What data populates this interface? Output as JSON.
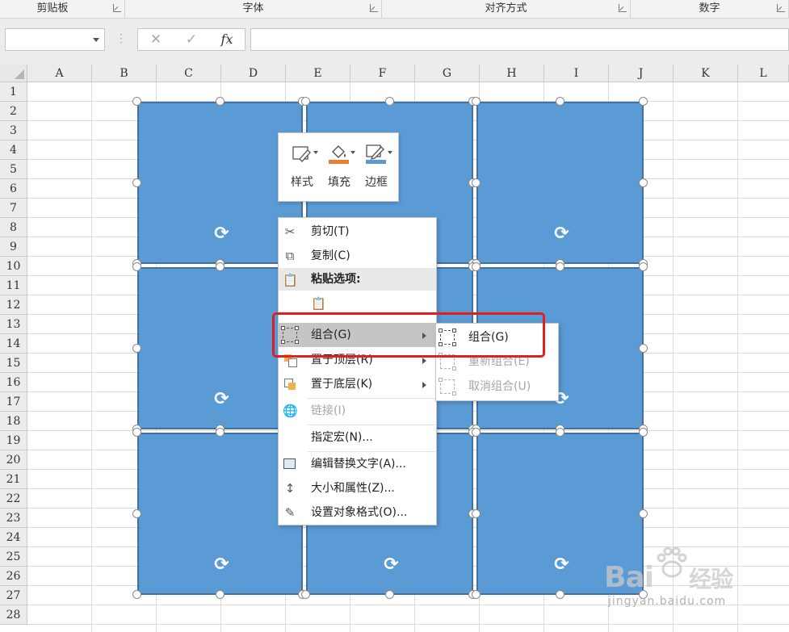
{
  "ribbon": {
    "groups": [
      "剪贴板",
      "字体",
      "对齐方式",
      "数字"
    ]
  },
  "formula_bar": {
    "name_box_value": "",
    "cancel_symbol": "✕",
    "enter_symbol": "✓",
    "fx_label": "fx",
    "formula_value": ""
  },
  "sheet": {
    "columns": [
      "A",
      "B",
      "C",
      "D",
      "E",
      "F",
      "G",
      "H",
      "I",
      "J",
      "K",
      "L"
    ],
    "rows": [
      "1",
      "2",
      "3",
      "4",
      "5",
      "6",
      "7",
      "8",
      "9",
      "10",
      "11",
      "12",
      "13",
      "14",
      "15",
      "16",
      "17",
      "18",
      "19",
      "20",
      "21",
      "22",
      "23",
      "24",
      "25",
      "26",
      "27",
      "28"
    ]
  },
  "shapes": {
    "fill_color": "#5b9bd5",
    "count": 9,
    "selected": true
  },
  "mini_toolbar": {
    "style_label": "样式",
    "fill_label": "填充",
    "border_label": "边框",
    "fill_accent": "#ed7d31",
    "border_accent": "#5b9bd5"
  },
  "context_menu": {
    "cut": "剪切(T)",
    "copy": "复制(C)",
    "paste_options": "粘贴选项:",
    "group": "组合(G)",
    "bring_to_front": "置于顶层(R)",
    "send_to_back": "置于底层(K)",
    "link": "链接(I)",
    "assign_macro": "指定宏(N)...",
    "edit_alt_text": "编辑替换文字(A)...",
    "size_properties": "大小和属性(Z)...",
    "format_object": "设置对象格式(O)..."
  },
  "submenu": {
    "group": "组合(G)",
    "regroup": "重新组合(E)",
    "ungroup": "取消组合(U)"
  },
  "highlight_color": "#e02020",
  "watermark": {
    "logo": "Bai",
    "logo_suffix": "经验",
    "url": "jingyan.baidu.com"
  }
}
